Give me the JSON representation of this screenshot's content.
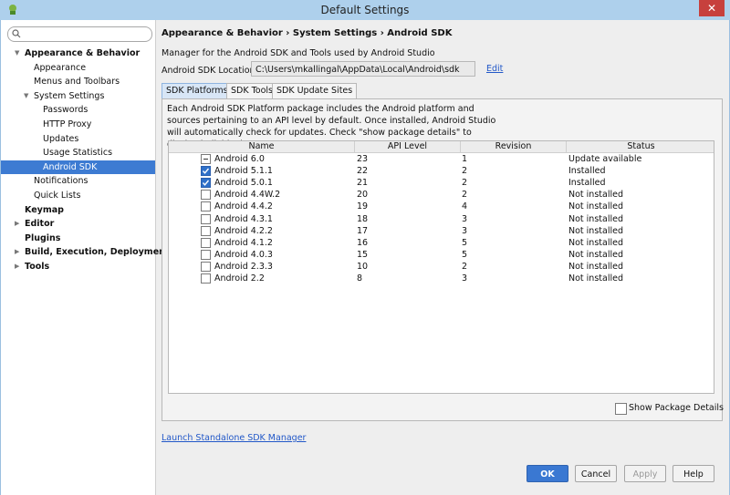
{
  "window": {
    "title": "Default Settings"
  },
  "search": {
    "placeholder": ""
  },
  "sidebar": {
    "items": [
      {
        "label": "Appearance & Behavior",
        "level": 0,
        "bold": true,
        "arrow": "expanded"
      },
      {
        "label": "Appearance",
        "level": 1
      },
      {
        "label": "Menus and Toolbars",
        "level": 1
      },
      {
        "label": "System Settings",
        "level": 1,
        "arrow": "expanded"
      },
      {
        "label": "Passwords",
        "level": 2
      },
      {
        "label": "HTTP Proxy",
        "level": 2
      },
      {
        "label": "Updates",
        "level": 2
      },
      {
        "label": "Usage Statistics",
        "level": 2
      },
      {
        "label": "Android SDK",
        "level": 2,
        "selected": true
      },
      {
        "label": "Notifications",
        "level": 1
      },
      {
        "label": "Quick Lists",
        "level": 1
      },
      {
        "label": "Keymap",
        "level": 0,
        "bold": true
      },
      {
        "label": "Editor",
        "level": 0,
        "bold": true,
        "arrow": "collapsed"
      },
      {
        "label": "Plugins",
        "level": 0,
        "bold": true
      },
      {
        "label": "Build, Execution, Deployment",
        "level": 0,
        "bold": true,
        "arrow": "collapsed"
      },
      {
        "label": "Tools",
        "level": 0,
        "bold": true,
        "arrow": "collapsed"
      }
    ]
  },
  "main": {
    "breadcrumb": "Appearance & Behavior › System Settings › Android SDK",
    "description": "Manager for the Android SDK and Tools used by Android Studio",
    "location_label": "Android SDK Location:",
    "location_value": "C:\\Users\\mkallingal\\AppData\\Local\\Android\\sdk",
    "edit_label": "Edit",
    "tabs": [
      {
        "label": "SDK Platforms",
        "active": true
      },
      {
        "label": "SDK Tools"
      },
      {
        "label": "SDK Update Sites"
      }
    ],
    "panel_description": "Each Android SDK Platform package includes the Android platform and sources pertaining to an API level by default. Once installed, Android Studio will automatically check for updates. Check \"show package details\" to display individual SDK components.",
    "table": {
      "headers": [
        "Name",
        "API Level",
        "Revision",
        "Status"
      ],
      "rows": [
        {
          "name": "Android 6.0",
          "api": "23",
          "rev": "1",
          "status": "Update available",
          "check": "partial"
        },
        {
          "name": "Android 5.1.1",
          "api": "22",
          "rev": "2",
          "status": "Installed",
          "check": "checked"
        },
        {
          "name": "Android 5.0.1",
          "api": "21",
          "rev": "2",
          "status": "Installed",
          "check": "checked"
        },
        {
          "name": "Android 4.4W.2",
          "api": "20",
          "rev": "2",
          "status": "Not installed",
          "check": "none"
        },
        {
          "name": "Android 4.4.2",
          "api": "19",
          "rev": "4",
          "status": "Not installed",
          "check": "none"
        },
        {
          "name": "Android 4.3.1",
          "api": "18",
          "rev": "3",
          "status": "Not installed",
          "check": "none"
        },
        {
          "name": "Android 4.2.2",
          "api": "17",
          "rev": "3",
          "status": "Not installed",
          "check": "none"
        },
        {
          "name": "Android 4.1.2",
          "api": "16",
          "rev": "5",
          "status": "Not installed",
          "check": "none"
        },
        {
          "name": "Android 4.0.3",
          "api": "15",
          "rev": "5",
          "status": "Not installed",
          "check": "none"
        },
        {
          "name": "Android 2.3.3",
          "api": "10",
          "rev": "2",
          "status": "Not installed",
          "check": "none"
        },
        {
          "name": "Android 2.2",
          "api": "8",
          "rev": "3",
          "status": "Not installed",
          "check": "none"
        }
      ]
    },
    "show_details_label": "Show Package Details",
    "launch_link": "Launch Standalone SDK Manager"
  },
  "buttons": {
    "ok": "OK",
    "cancel": "Cancel",
    "apply": "Apply",
    "help": "Help"
  },
  "colors": {
    "selection": "#3d7bd2",
    "link": "#2258c8",
    "ok_button": "#3a78d2",
    "close_button": "#c7403d"
  }
}
